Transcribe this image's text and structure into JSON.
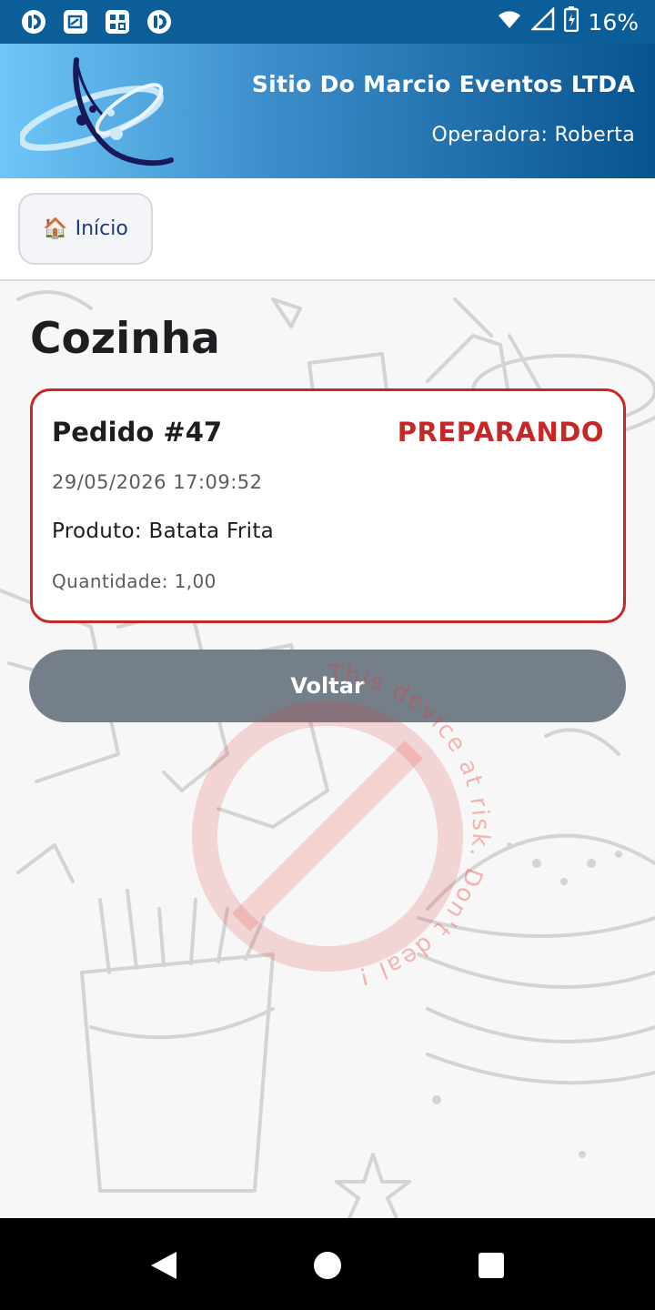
{
  "status_bar": {
    "left_icons": [
      "app-notification-icon",
      "screen-cast-icon",
      "qr-app-icon",
      "app-notification-icon"
    ],
    "battery_percent": "16%",
    "right_icons": [
      "wifi-icon",
      "cellular-signal-icon",
      "battery-charging-icon"
    ]
  },
  "header": {
    "company_name": "Sitio Do Marcio Eventos LTDA",
    "operator_label": "Operadora: Roberta"
  },
  "nav": {
    "home_emoji": "🏠",
    "home_label": "Início"
  },
  "page": {
    "title": "Cozinha"
  },
  "order": {
    "number": "Pedido #47",
    "status": "PREPARANDO",
    "datetime": "29/05/2026 17:09:52",
    "product": "Produto: Batata Frita",
    "quantity": "Quantidade: 1,00"
  },
  "actions": {
    "back_label": "Voltar"
  },
  "watermark": {
    "text": "This device at risk. Don't deal !"
  },
  "colors": {
    "status_bar": "#0c5e99",
    "header_gradient_start": "#6ec6f8",
    "header_gradient_end": "#07538e",
    "status_accent": "#c62828",
    "back_button": "#757f8a"
  }
}
